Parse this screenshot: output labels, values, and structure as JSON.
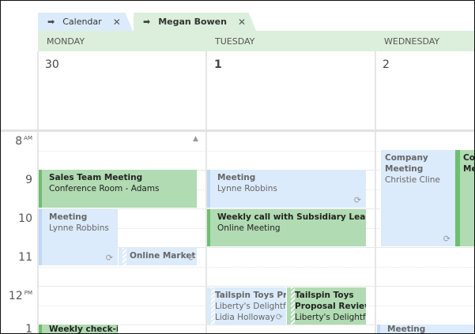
{
  "tabs": [
    {
      "label": "Calendar",
      "close": "✕"
    },
    {
      "label": "Megan Bowen",
      "close": "✕"
    }
  ],
  "days": [
    {
      "name": "MONDAY",
      "num": "30"
    },
    {
      "name": "TUESDAY",
      "num": "1"
    },
    {
      "name": "WEDNESDAY",
      "num": "2"
    }
  ],
  "hours": [
    {
      "h": "8",
      "ap": "AM"
    },
    {
      "h": "9",
      "ap": ""
    },
    {
      "h": "10",
      "ap": ""
    },
    {
      "h": "11",
      "ap": ""
    },
    {
      "h": "12",
      "ap": "PM"
    },
    {
      "h": "1",
      "ap": ""
    }
  ],
  "events": {
    "mon_sales": {
      "title": "Sales Team Meeting",
      "loc": "Conference Room - Adams"
    },
    "mon_meeting": {
      "title": "Meeting",
      "loc": "Lynne Robbins"
    },
    "mon_online": {
      "title": "Online Market"
    },
    "mon_weekly": {
      "title": "Weekly check-in"
    },
    "tue_meeting": {
      "title": "Meeting",
      "loc": "Lynne Robbins"
    },
    "tue_weekly": {
      "title": "Weekly call with Subsidiary Leads",
      "loc": "Online Meeting"
    },
    "tue_tailspin1": {
      "title": "Tailspin Toys Pro",
      "loc": "Liberty's Delightful",
      "person": "Lidia Holloway"
    },
    "tue_tailspin2": {
      "title": "Tailspin Toys",
      "title2": "Proposal Review",
      "loc": "Liberty's Delightful"
    },
    "wed_company": {
      "title": "Company",
      "title2": "Meeting",
      "loc": "Christie Cline"
    },
    "wed_co2": {
      "title": "Co",
      "title2": "Me"
    },
    "wed_meeting": {
      "title": "Meeting"
    }
  },
  "colors": {
    "accepted": "#b1dbb2",
    "tentative": "#dcebfb",
    "header": "#dcefdc"
  }
}
